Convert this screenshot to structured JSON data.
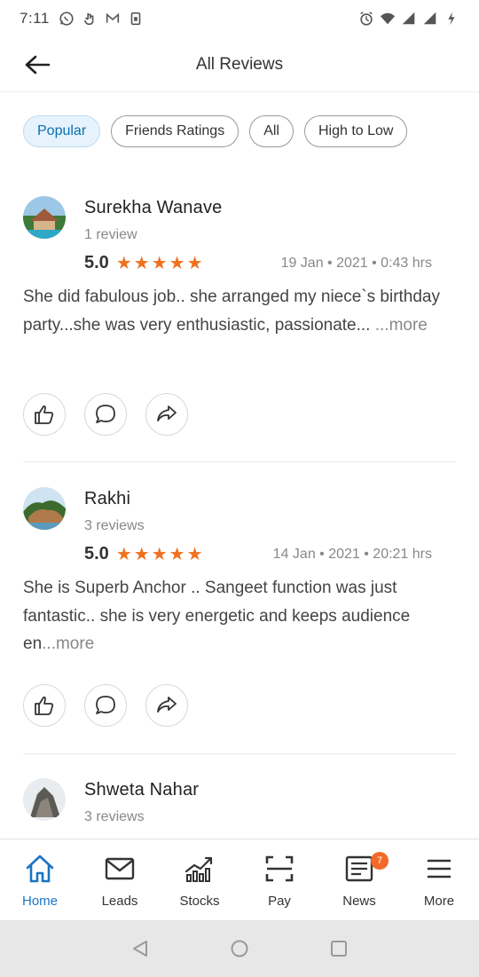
{
  "status_bar": {
    "time": "7:11"
  },
  "header": {
    "title": "All Reviews"
  },
  "filters": [
    {
      "label": "Popular",
      "active": true
    },
    {
      "label": "Friends Ratings",
      "active": false
    },
    {
      "label": "All",
      "active": false
    },
    {
      "label": "High to Low",
      "active": false
    }
  ],
  "reviews": [
    {
      "name": "Surekha Wanave",
      "count": "1 review",
      "rating": "5.0",
      "stars": 5,
      "date": "19 Jan • 2021 • 0:43 hrs",
      "text": "She did fabulous job.. she arranged my niece`s birthday party...she was very enthusiastic, passionate... ",
      "more": "...more"
    },
    {
      "name": "Rakhi",
      "count": "3 reviews",
      "rating": "5.0",
      "stars": 5,
      "date": "14 Jan • 2021 • 20:21 hrs",
      "text": "She is Superb Anchor .. Sangeet function was just fantastic.. she is very energetic and keeps audience en",
      "more": "...more"
    },
    {
      "name": "Shweta Nahar",
      "count": "3 reviews"
    }
  ],
  "bottom_nav": [
    {
      "label": "Home",
      "icon": "home-icon",
      "active": true
    },
    {
      "label": "Leads",
      "icon": "mail-icon"
    },
    {
      "label": "Stocks",
      "icon": "stocks-chart-icon"
    },
    {
      "label": "Pay",
      "icon": "scan-icon"
    },
    {
      "label": "News",
      "icon": "news-icon",
      "badge": "7"
    },
    {
      "label": "More",
      "icon": "menu-icon"
    }
  ],
  "colors": {
    "accent": "#1a74c4",
    "star": "#f0701e",
    "badge": "#f26a2a",
    "chip_active_bg": "#e6f3fc"
  }
}
